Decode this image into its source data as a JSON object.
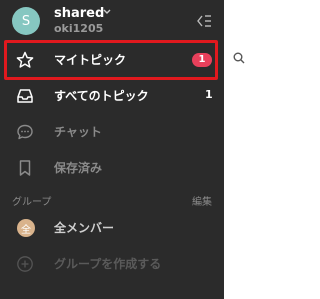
{
  "workspace": {
    "avatar_letter": "S",
    "name": "shared",
    "user": "oki1205"
  },
  "nav": {
    "my_topics": {
      "label": "マイトピック",
      "badge": "1"
    },
    "all_topics": {
      "label": "すべてのトピック",
      "count": "1"
    },
    "chat": {
      "label": "チャット"
    },
    "saved": {
      "label": "保存済み"
    }
  },
  "groups": {
    "title": "グループ",
    "edit_label": "編集",
    "items": [
      {
        "avatar_letter": "全",
        "label": "全メンバー"
      }
    ],
    "create_label": "グループを作成する"
  },
  "colors": {
    "sidebar_bg": "#2b2b2b",
    "badge": "#e8405b",
    "highlight": "#e0191e",
    "avatar": "#86c7c1"
  }
}
